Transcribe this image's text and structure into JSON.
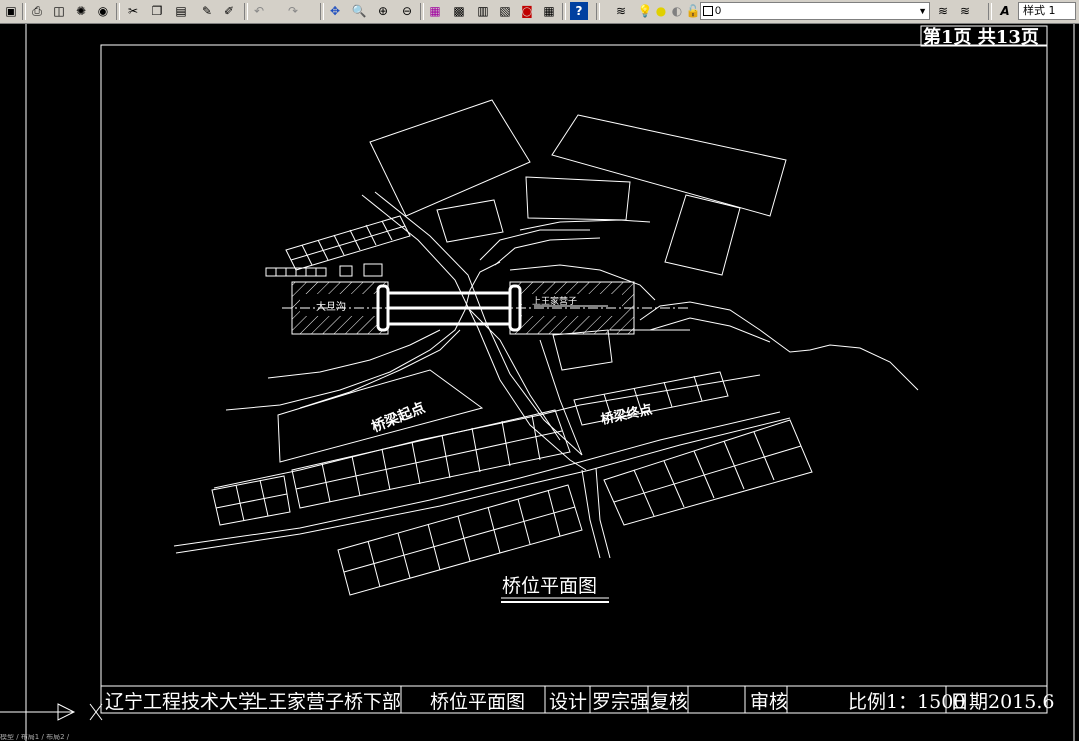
{
  "toolbar": {
    "layer_value": "0",
    "text_style_value": "样式 1",
    "buttons": [
      "save-icon",
      "print-icon",
      "print-preview-icon",
      "publish-icon",
      "etransmit-icon",
      "cut-icon",
      "copy-icon",
      "paste-icon",
      "match-properties-icon",
      "block-editor-icon",
      "undo-icon",
      "redo-icon",
      "pan-icon",
      "zoom-realtime-icon",
      "zoom-window-icon",
      "zoom-previous-icon",
      "properties-icon",
      "design-center-icon",
      "tool-palette-icon",
      "sheet-set-icon",
      "markup-icon",
      "calculator-icon",
      "help-icon",
      "layer-properties-icon",
      "layer-state-icon"
    ]
  },
  "drawing": {
    "page_label": "第1页  共13页",
    "title": "桥位平面图",
    "label_start": "桥梁起点",
    "label_end": "桥梁终点",
    "label_left_village": "大旦沟",
    "label_right_village": "上王家营子"
  },
  "title_block": {
    "school": "辽宁工程技术大学",
    "project": "上王家营子桥下部",
    "drawing_name": "桥位平面图",
    "design_label": "设计",
    "designer": "罗宗强",
    "recheck_label": "复核",
    "review_label": "审核",
    "scale": "比例1：1500",
    "date": "日期2015.6"
  },
  "status_text": "模型 / 布局1 / 布局2 /",
  "colors": {
    "background": "#000000",
    "lines": "#ffffff",
    "toolbar": "#d4d0c8"
  }
}
